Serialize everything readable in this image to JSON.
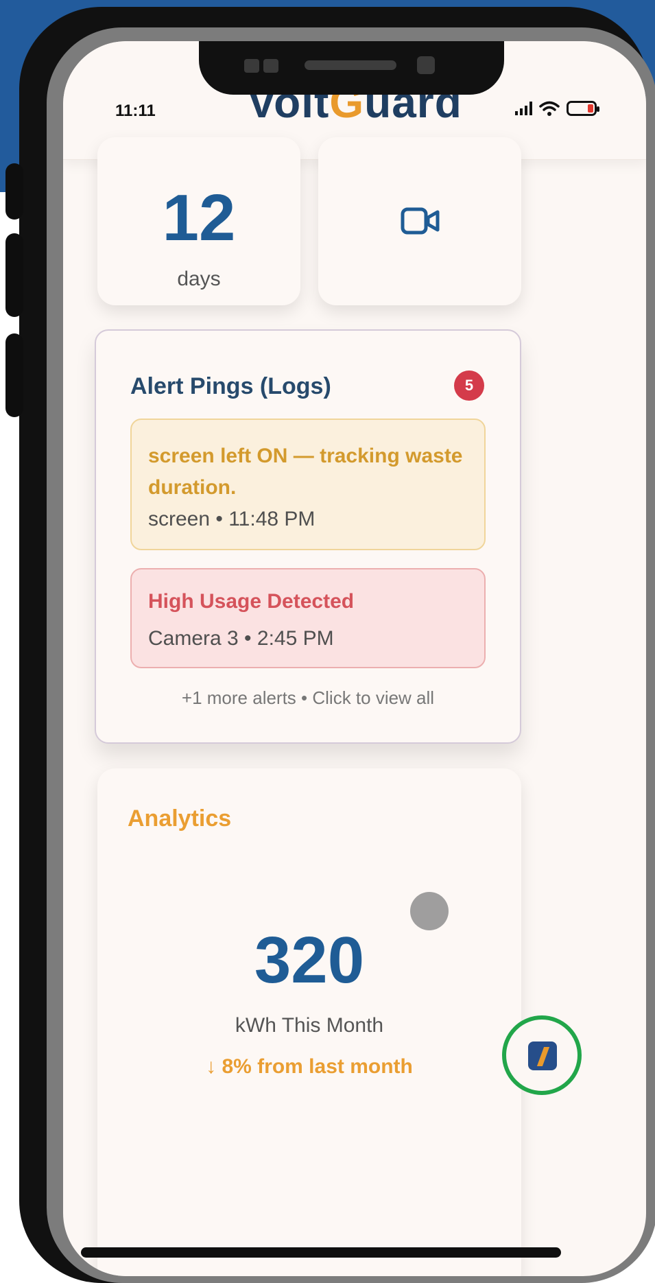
{
  "status_bar": {
    "time": "11:11"
  },
  "app": {
    "brand_part1": "Volt",
    "brand_bolt": "G",
    "brand_part2": "uard"
  },
  "stats": {
    "days_value": "12",
    "days_unit": "days",
    "camera_icon": "video-camera-icon"
  },
  "alerts": {
    "title": "Alert Pings (Logs)",
    "count": "5",
    "items": [
      {
        "title": "screen left ON — tracking waste duration.",
        "meta": "screen • 11:48 PM",
        "severity": "warning"
      },
      {
        "title": "High Usage Detected",
        "meta": "Camera 3 • 2:45 PM",
        "severity": "danger"
      }
    ],
    "more_text": "+1 more alerts • Click to view all"
  },
  "analytics": {
    "title": "Analytics",
    "kwh_value": "320",
    "kwh_label": "kWh This Month",
    "change_text": "↓ 8% from last month"
  },
  "colors": {
    "background_band": "#225b9c",
    "primary": "#1f5c95",
    "accent": "#ea9e32",
    "danger": "#d43b4a",
    "fab_ring": "#22a64a"
  }
}
